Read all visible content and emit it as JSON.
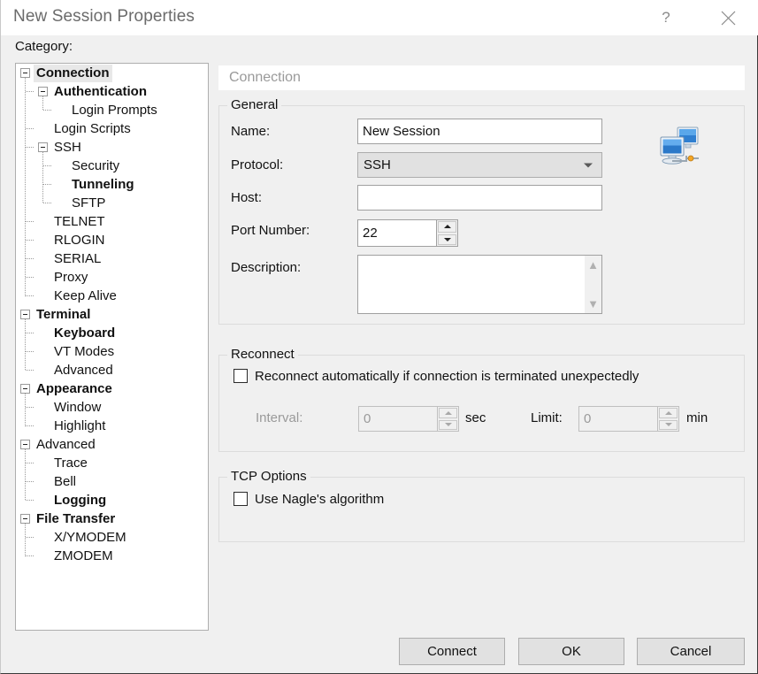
{
  "window": {
    "title": "New Session Properties",
    "help_icon": "question-mark-icon",
    "close_icon": "close-icon"
  },
  "category": {
    "label": "Category:",
    "tree": [
      {
        "label": "Connection",
        "level": 0,
        "bold": true,
        "selected": true,
        "expander": "minus"
      },
      {
        "label": "Authentication",
        "level": 1,
        "bold": true,
        "selected": false,
        "expander": "minus"
      },
      {
        "label": "Login Prompts",
        "level": 2,
        "bold": false,
        "selected": false,
        "expander": "leaf"
      },
      {
        "label": "Login Scripts",
        "level": 1,
        "bold": false,
        "selected": false,
        "expander": "leaf"
      },
      {
        "label": "SSH",
        "level": 1,
        "bold": false,
        "selected": false,
        "expander": "minus"
      },
      {
        "label": "Security",
        "level": 2,
        "bold": false,
        "selected": false,
        "expander": "leaf"
      },
      {
        "label": "Tunneling",
        "level": 2,
        "bold": true,
        "selected": false,
        "expander": "leaf"
      },
      {
        "label": "SFTP",
        "level": 2,
        "bold": false,
        "selected": false,
        "expander": "leaf"
      },
      {
        "label": "TELNET",
        "level": 1,
        "bold": false,
        "selected": false,
        "expander": "leaf"
      },
      {
        "label": "RLOGIN",
        "level": 1,
        "bold": false,
        "selected": false,
        "expander": "leaf"
      },
      {
        "label": "SERIAL",
        "level": 1,
        "bold": false,
        "selected": false,
        "expander": "leaf"
      },
      {
        "label": "Proxy",
        "level": 1,
        "bold": false,
        "selected": false,
        "expander": "leaf"
      },
      {
        "label": "Keep Alive",
        "level": 1,
        "bold": false,
        "selected": false,
        "expander": "leaf"
      },
      {
        "label": "Terminal",
        "level": 0,
        "bold": true,
        "selected": false,
        "expander": "minus"
      },
      {
        "label": "Keyboard",
        "level": 1,
        "bold": true,
        "selected": false,
        "expander": "leaf"
      },
      {
        "label": "VT Modes",
        "level": 1,
        "bold": false,
        "selected": false,
        "expander": "leaf"
      },
      {
        "label": "Advanced",
        "level": 1,
        "bold": false,
        "selected": false,
        "expander": "leaf"
      },
      {
        "label": "Appearance",
        "level": 0,
        "bold": true,
        "selected": false,
        "expander": "minus"
      },
      {
        "label": "Window",
        "level": 1,
        "bold": false,
        "selected": false,
        "expander": "leaf"
      },
      {
        "label": "Highlight",
        "level": 1,
        "bold": false,
        "selected": false,
        "expander": "leaf"
      },
      {
        "label": "Advanced",
        "level": 0,
        "bold": false,
        "selected": false,
        "expander": "minus"
      },
      {
        "label": "Trace",
        "level": 1,
        "bold": false,
        "selected": false,
        "expander": "leaf"
      },
      {
        "label": "Bell",
        "level": 1,
        "bold": false,
        "selected": false,
        "expander": "leaf"
      },
      {
        "label": "Logging",
        "level": 1,
        "bold": true,
        "selected": false,
        "expander": "leaf"
      },
      {
        "label": "File Transfer",
        "level": 0,
        "bold": true,
        "selected": false,
        "expander": "minus"
      },
      {
        "label": "X/YMODEM",
        "level": 1,
        "bold": false,
        "selected": false,
        "expander": "leaf"
      },
      {
        "label": "ZMODEM",
        "level": 1,
        "bold": false,
        "selected": false,
        "expander": "leaf"
      }
    ]
  },
  "page": {
    "header": "Connection",
    "general": {
      "title": "General",
      "name_label": "Name:",
      "name_value": "New Session",
      "protocol_label": "Protocol:",
      "protocol_value": "SSH",
      "protocol_options": [
        "SSH"
      ],
      "host_label": "Host:",
      "host_value": "",
      "host_placeholder": "",
      "port_label": "Port Number:",
      "port_value": "22",
      "description_label": "Description:",
      "description_value": "",
      "icon": "network-computers-icon"
    },
    "reconnect": {
      "title": "Reconnect",
      "auto_label": "Reconnect automatically if connection is terminated unexpectedly",
      "auto_checked": false,
      "interval_label": "Interval:",
      "interval_value": "0",
      "interval_unit": "sec",
      "limit_label": "Limit:",
      "limit_value": "0",
      "limit_unit": "min"
    },
    "tcp": {
      "title": "TCP Options",
      "nagle_label": "Use Nagle's algorithm",
      "nagle_checked": false
    }
  },
  "buttons": {
    "connect": "Connect",
    "ok": "OK",
    "cancel": "Cancel"
  },
  "colors": {
    "dialog_bg": "#f0f0f0",
    "titlebar_bg": "#ffffff",
    "title_text": "#6b6b6b",
    "header_text": "#9a9a9a",
    "field_border": "#a0a0a0",
    "group_border": "#dcdcdc",
    "button_bg": "#e1e1e1",
    "selected_row_bg": "#e8e8e8"
  }
}
